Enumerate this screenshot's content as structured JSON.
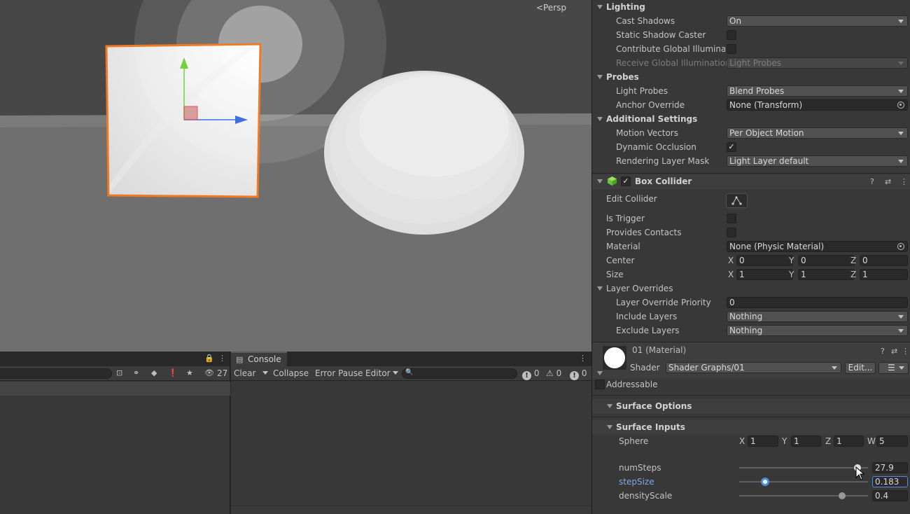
{
  "scene": {
    "persp_label": "Persp"
  },
  "inspector": {
    "lighting": {
      "header": "Lighting",
      "cast_shadows_label": "Cast Shadows",
      "cast_shadows_value": "On",
      "static_shadow_label": "Static Shadow Caster",
      "contribute_gi_label": "Contribute Global Illuminatic",
      "receive_gi_label": "Receive Global Illumination",
      "receive_gi_value": "Light Probes"
    },
    "probes": {
      "header": "Probes",
      "light_probes_label": "Light Probes",
      "light_probes_value": "Blend Probes",
      "anchor_override_label": "Anchor Override",
      "anchor_override_value": "None (Transform)"
    },
    "additional": {
      "header": "Additional Settings",
      "motion_vectors_label": "Motion Vectors",
      "motion_vectors_value": "Per Object Motion",
      "dynamic_occlusion_label": "Dynamic Occlusion",
      "rendering_layer_label": "Rendering Layer Mask",
      "rendering_layer_value": "Light Layer default"
    },
    "box_collider": {
      "title": "Box Collider",
      "edit_collider_label": "Edit Collider",
      "is_trigger_label": "Is Trigger",
      "provides_contacts_label": "Provides Contacts",
      "material_label": "Material",
      "material_value": "None (Physic Material)",
      "center_label": "Center",
      "center": {
        "x": "0",
        "y": "0",
        "z": "0"
      },
      "size_label": "Size",
      "size": {
        "x": "1",
        "y": "1",
        "z": "1"
      },
      "layer_overrides_label": "Layer Overrides",
      "priority_label": "Layer Override Priority",
      "priority_value": "0",
      "include_layers_label": "Include Layers",
      "include_layers_value": "Nothing",
      "exclude_layers_label": "Exclude Layers",
      "exclude_layers_value": "Nothing"
    },
    "material": {
      "title": "01 (Material)",
      "shader_label": "Shader",
      "shader_value": "Shader Graphs/01",
      "edit_label": "Edit...",
      "addressable_label": "Addressable",
      "surface_options_label": "Surface Options",
      "surface_inputs_label": "Surface Inputs",
      "sphere_label": "Sphere",
      "sphere": {
        "x": "1",
        "y": "1",
        "z": "1",
        "w": "5"
      },
      "num_steps_label": "numSteps",
      "num_steps_value": "27.9",
      "step_size_label": "stepSize",
      "step_size_value": "0.183",
      "density_scale_label": "densityScale",
      "density_scale_value": "0.4"
    },
    "axis": {
      "x": "X",
      "y": "Y",
      "z": "Z",
      "w": "W"
    }
  },
  "project_panel": {
    "count": "27"
  },
  "console": {
    "tab_label": "Console",
    "clear_label": "Clear",
    "collapse_label": "Collapse",
    "error_pause_label": "Error Pause",
    "editor_label": "Editor",
    "info_count": "0",
    "warn_count": "0",
    "error_count": "0"
  },
  "sliders": {
    "num_steps_fraction": 0.92,
    "step_size_fraction": 0.2,
    "density_scale_fraction": 0.8
  },
  "colors": {
    "selection_outline": "#f07a23",
    "accent_blue": "#4c8fe0",
    "gizmo_green": "#72d33a",
    "gizmo_blue": "#3e6fe8"
  }
}
